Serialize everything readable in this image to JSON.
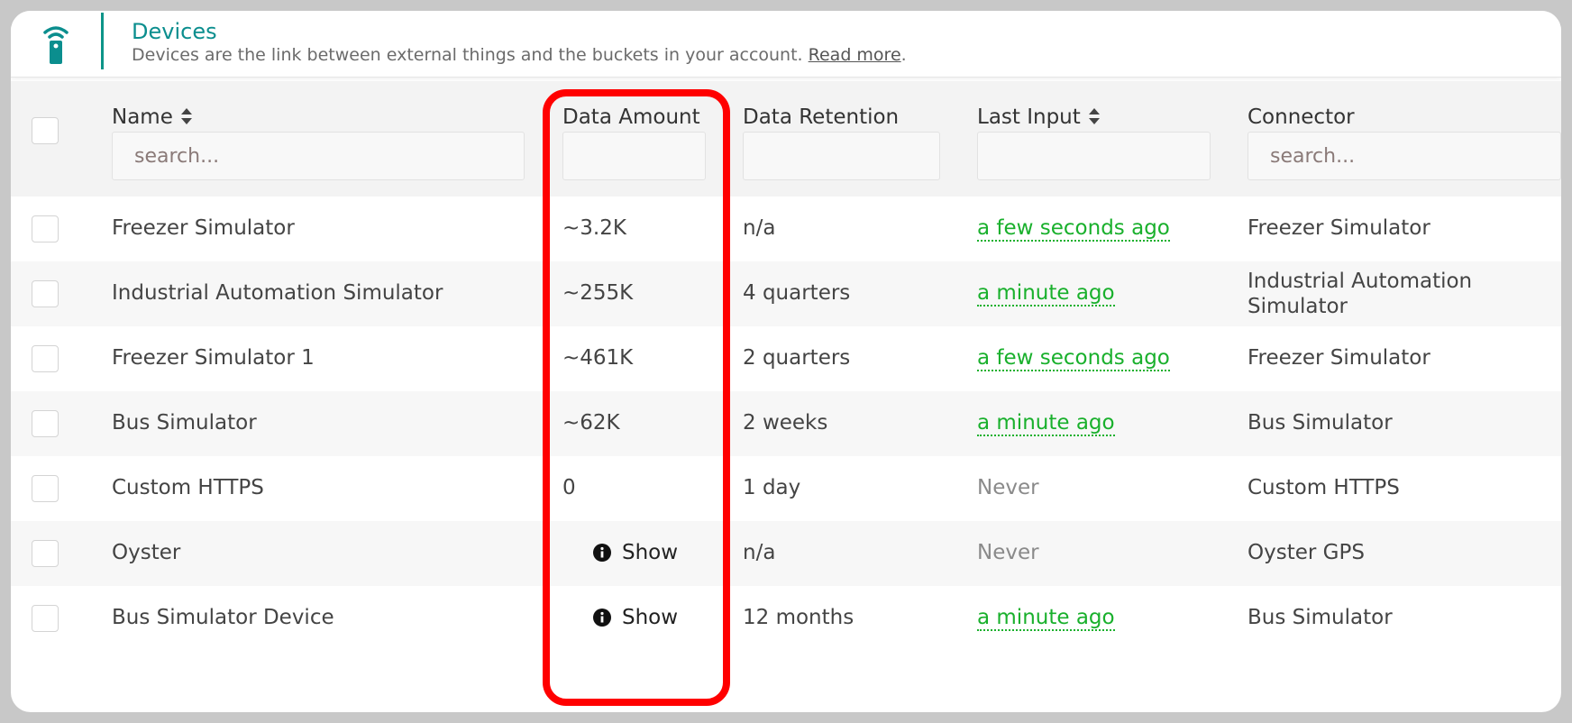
{
  "header": {
    "icon": "remote-device-icon",
    "title": "Devices",
    "description": "Devices are the link between external things and the buckets in your account.",
    "read_more": "Read more",
    "period": "."
  },
  "columns": {
    "name": {
      "label": "Name",
      "placeholder": "search...",
      "sortable": true
    },
    "data_amount": {
      "label": "Data Amount",
      "placeholder": ""
    },
    "data_retention": {
      "label": "Data Retention",
      "placeholder": ""
    },
    "last_input": {
      "label": "Last Input",
      "placeholder": "",
      "sortable": true
    },
    "connector": {
      "label": "Connector",
      "placeholder": "search..."
    }
  },
  "rows": [
    {
      "name": "Freezer Simulator",
      "data_amount": "~3.2K",
      "data_retention": "n/a",
      "last_input": "a few seconds ago",
      "last_input_state": "recent",
      "connector": "Freezer Simulator"
    },
    {
      "name": "Industrial Automation Simulator",
      "data_amount": "~255K",
      "data_retention": "4 quarters",
      "last_input": "a minute ago",
      "last_input_state": "recent",
      "connector": "Industrial Automation Simulator"
    },
    {
      "name": "Freezer Simulator 1",
      "data_amount": "~461K",
      "data_retention": "2 quarters",
      "last_input": "a few seconds ago",
      "last_input_state": "recent",
      "connector": "Freezer Simulator"
    },
    {
      "name": "Bus Simulator",
      "data_amount": "~62K",
      "data_retention": "2 weeks",
      "last_input": "a minute ago",
      "last_input_state": "recent",
      "connector": "Bus Simulator"
    },
    {
      "name": "Custom HTTPS",
      "data_amount": "0",
      "data_retention": "1 day",
      "last_input": "Never",
      "last_input_state": "never",
      "connector": "Custom HTTPS"
    },
    {
      "name": "Oyster",
      "data_amount": "Show",
      "data_amount_is_button": true,
      "data_retention": "n/a",
      "last_input": "Never",
      "last_input_state": "never",
      "connector": "Oyster GPS"
    },
    {
      "name": "Bus Simulator Device",
      "data_amount": "Show",
      "data_amount_is_button": true,
      "data_retention": "12 months",
      "last_input": "a minute ago",
      "last_input_state": "recent",
      "connector": "Bus Simulator"
    }
  ],
  "colors": {
    "accent": "#0b8e8e",
    "recent": "#19b02c",
    "never": "#8a8a8a",
    "highlight": "#ff0000"
  }
}
